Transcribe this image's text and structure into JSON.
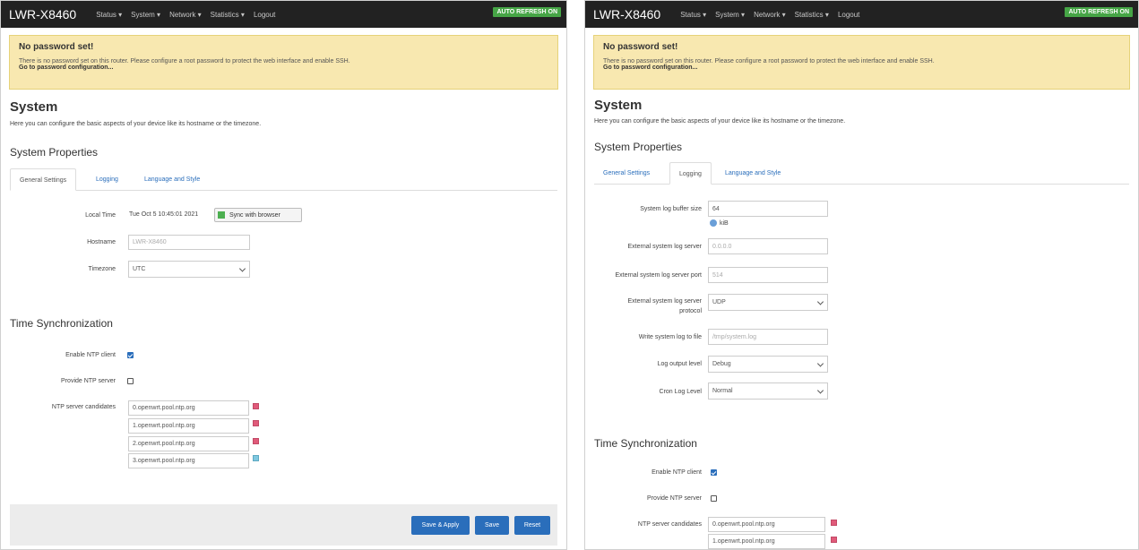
{
  "brand": "LWR-X8460",
  "nav": [
    "Status",
    "System",
    "Network",
    "Statistics",
    "Logout"
  ],
  "auto_refresh": "AUTO REFRESH ON",
  "alert": {
    "title": "No password set!",
    "text": "There is no password set on this router. Please configure a root password to protect the web interface and enable SSH.",
    "link": "Go to password configuration..."
  },
  "page": {
    "title": "System",
    "description": "Here you can configure the basic aspects of your device like its hostname or the timezone.",
    "section_properties": "System Properties",
    "section_time": "Time Synchronization"
  },
  "tabs": [
    "General Settings",
    "Logging",
    "Language and Style"
  ],
  "general": {
    "local_time_label": "Local Time",
    "local_time_value": "Tue Oct 5 10:45:01 2021",
    "sync_button": "Sync with browser",
    "hostname_label": "Hostname",
    "hostname_value": "LWR-X8460",
    "timezone_label": "Timezone",
    "timezone_value": "UTC"
  },
  "logging": {
    "buffer_label": "System log buffer size",
    "buffer_value": "64",
    "buffer_unit": "kiB",
    "ext_server_label": "External system log server",
    "ext_server_placeholder": "0.0.0.0",
    "ext_port_label": "External system log server port",
    "ext_port_placeholder": "514",
    "ext_protocol_label_1": "External system log server",
    "ext_protocol_label_2": "protocol",
    "ext_protocol_value": "UDP",
    "write_file_label": "Write system log to file",
    "write_file_placeholder": "/tmp/system.log",
    "output_level_label": "Log output level",
    "output_level_value": "Debug",
    "cron_level_label": "Cron Log Level",
    "cron_level_value": "Normal"
  },
  "time": {
    "enable_ntp_label": "Enable NTP client",
    "provide_ntp_label": "Provide NTP server",
    "candidates_label": "NTP server candidates",
    "servers": [
      "0.openwrt.pool.ntp.org",
      "1.openwrt.pool.ntp.org",
      "2.openwrt.pool.ntp.org",
      "3.openwrt.pool.ntp.org"
    ]
  },
  "buttons": {
    "save_apply": "Save & Apply",
    "save": "Save",
    "reset": "Reset"
  },
  "colors": {
    "navbar": "#222222",
    "auto_refresh": "#46a546",
    "alert_bg": "#f8e8b0",
    "link": "#2a6ebb",
    "primary_button": "#2a6ebb"
  }
}
